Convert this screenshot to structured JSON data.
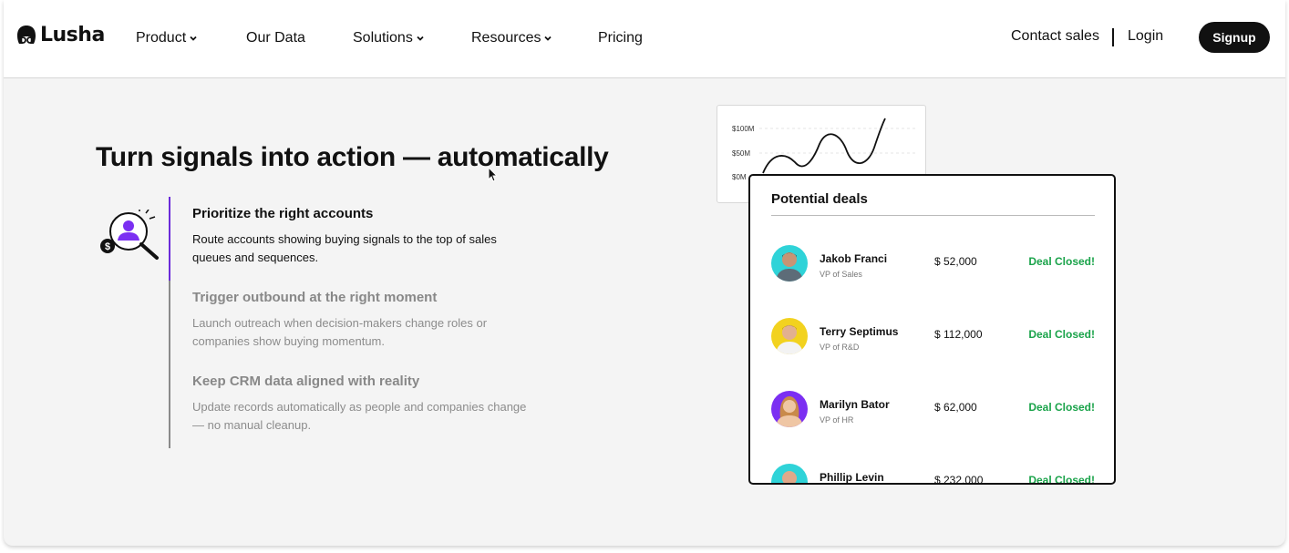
{
  "nav": {
    "logo": "Lusha",
    "items": [
      {
        "label": "Product",
        "dropdown": true
      },
      {
        "label": "Our Data",
        "dropdown": false
      },
      {
        "label": "Solutions",
        "dropdown": true
      },
      {
        "label": "Resources",
        "dropdown": true
      },
      {
        "label": "Pricing",
        "dropdown": false
      }
    ],
    "contact_sales": "Contact sales",
    "login": "Login",
    "signup": "Signup"
  },
  "hero": {
    "headline": "Turn signals into action — automatically",
    "features": [
      {
        "title": "Prioritize the right accounts",
        "description": "Route accounts showing buying signals to the top of sales queues and sequences.",
        "active": true
      },
      {
        "title": "Trigger outbound at the right moment",
        "description": "Launch outreach when decision-makers change roles or companies show buying momentum.",
        "active": false
      },
      {
        "title": "Keep CRM data aligned with reality",
        "description": "Update records automatically as people and companies change — no manual cleanup.",
        "active": false
      }
    ]
  },
  "chart": {
    "y_labels": [
      "$100M",
      "$50M",
      "$0M"
    ]
  },
  "deals": {
    "title": "Potential deals",
    "rows": [
      {
        "name": "Jakob Franci",
        "role": "VP of Sales",
        "amount": "$ 52,000",
        "status": "Deal Closed!",
        "avatar_bg": "#2fd3d8"
      },
      {
        "name": "Terry Septimus",
        "role": "VP of R&D",
        "amount": "$ 112,000",
        "status": "Deal Closed!",
        "avatar_bg": "#f2d21f"
      },
      {
        "name": "Marilyn Bator",
        "role": "VP of HR",
        "amount": "$ 62,000",
        "status": "Deal Closed!",
        "avatar_bg": "#7b2ff2"
      },
      {
        "name": "Phillip Levin",
        "role": "",
        "amount": "$ 232,000",
        "status": "Deal Closed!",
        "avatar_bg": "#2fd3d8"
      }
    ]
  },
  "colors": {
    "accent_purple": "#6b2bd9",
    "deal_green": "#1aa34a",
    "dark": "#111111"
  }
}
